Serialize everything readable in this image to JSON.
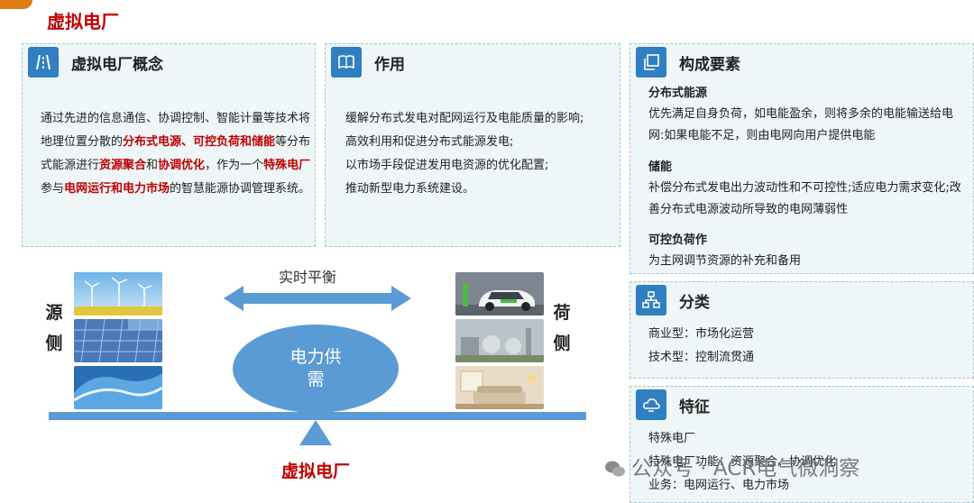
{
  "page_title": "虚拟电厂",
  "concept": {
    "title": "虚拟电厂概念",
    "icon": "road-icon",
    "segments": [
      {
        "text": "通过先进的信息通信、协调控制、智能计量等技术将地理位置分散的",
        "hl": false
      },
      {
        "text": "分布式电源、可控负荷和储能",
        "hl": true
      },
      {
        "text": "等分布式能源进行",
        "hl": false
      },
      {
        "text": "资源聚合",
        "hl": true
      },
      {
        "text": "和",
        "hl": false
      },
      {
        "text": "协调优化",
        "hl": true
      },
      {
        "text": "，作为一个",
        "hl": false
      },
      {
        "text": "特殊电厂",
        "hl": true
      },
      {
        "text": "参与",
        "hl": false
      },
      {
        "text": "电网运行和电力市场",
        "hl": true
      },
      {
        "text": "的智慧能源协调管理系统。",
        "hl": false
      }
    ]
  },
  "role": {
    "title": "作用",
    "icon": "book-icon",
    "items": [
      "缓解分布式发电对配网运行及电能质量的影响;",
      "高效利用和促进分布式能源发电;",
      "以市场手段促进发用电资源的优化配置;",
      "推动新型电力系统建设。"
    ]
  },
  "elements": {
    "title": "构成要素",
    "icon": "copy-icon",
    "items": [
      {
        "head": "分布式能源",
        "body": "优先满足自身负荷，如电能盈余，则将多余的电能输送给电网:如果电能不足，则由电网向用户提供电能"
      },
      {
        "head": "储能",
        "body": "补偿分布式发电出力波动性和不可控性;适应电力需求变化;改善分布式电源波动所导致的电网薄弱性"
      },
      {
        "head": "可控负荷作",
        "body": "为主网调节资源的补充和备用"
      }
    ]
  },
  "classification": {
    "title": "分类",
    "icon": "sitemap-icon",
    "items": [
      "商业型：市场化运营",
      "技术型：控制流贯通"
    ]
  },
  "features": {
    "title": "特征",
    "icon": "cloud-icon",
    "items": [
      "特殊电厂",
      "特殊电厂功能：资源聚合、协调优化",
      "业务：电网运行、电力市场"
    ]
  },
  "diagram": {
    "source_label": "源侧",
    "load_label": "荷侧",
    "balance_label": "实时平衡",
    "center_label": "电力供需",
    "bottom_label": "虚拟电厂",
    "source_images": [
      "wind-turbines-image",
      "solar-panels-image",
      "ocean-wave-image"
    ],
    "load_images": [
      "electric-car-image",
      "industrial-plant-image",
      "living-room-image"
    ]
  },
  "watermark": "公众号 · ACR电气微洞察",
  "colors": {
    "accent": "#2f7fc1",
    "highlight": "#c00000",
    "diagram": "#5b9bd5"
  }
}
